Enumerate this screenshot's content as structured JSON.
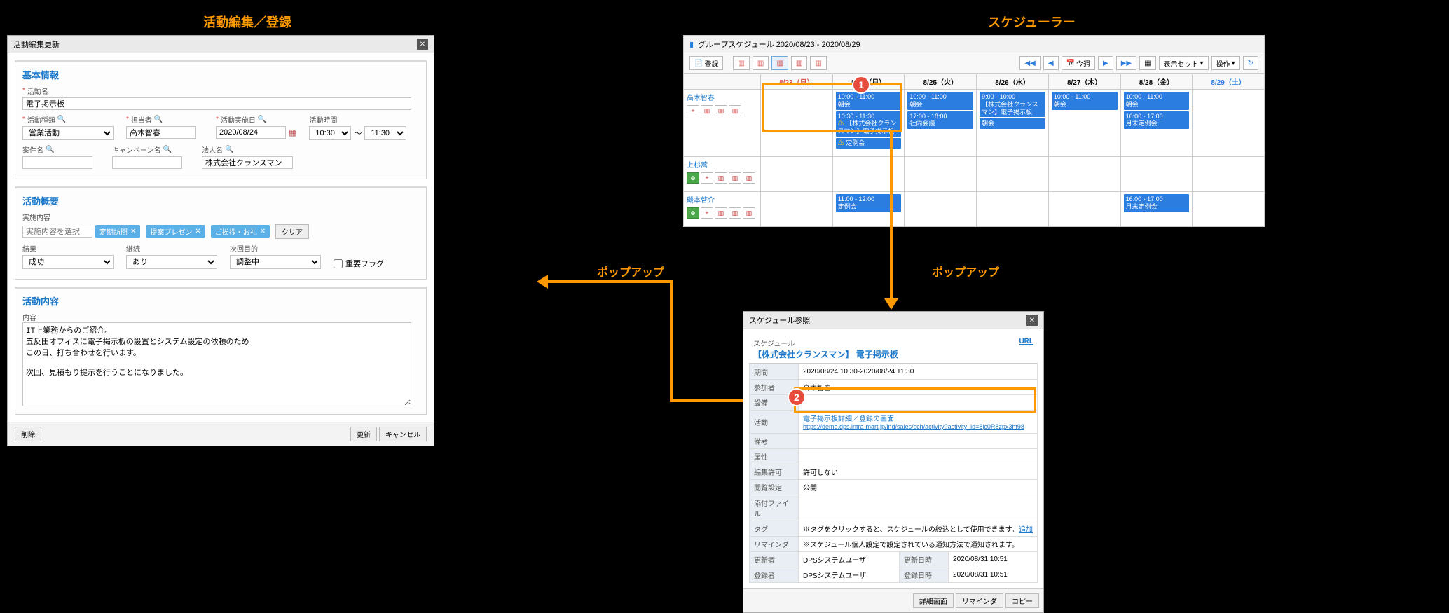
{
  "titles": {
    "left": "活動編集／登録",
    "right": "スケジューラー"
  },
  "editwin": {
    "title": "活動編集更新",
    "sec1": "基本情報",
    "f_name_l": "活動名",
    "f_name_v": "電子掲示板",
    "f_type_l": "活動種類",
    "f_type_v": "営業活動",
    "f_owner_l": "担当者",
    "f_owner_v": "高木智春",
    "f_date_l": "活動実施日",
    "f_date_v": "2020/08/24",
    "f_time_l": "活動時間",
    "f_time_from": "10:30",
    "f_time_to": "11:30",
    "f_acc_l": "案件名",
    "f_camp_l": "キャンペーン名",
    "f_corp_l": "法人名",
    "f_corp_v": "株式会社クランスマン",
    "sec2": "活動概要",
    "f_content_l": "実施内容",
    "f_content_ph": "実施内容を選択",
    "tag1": "定期訪問",
    "tag2": "提案プレゼン",
    "tag3": "ご挨拶・お礼",
    "clear": "クリア",
    "f_result_l": "結果",
    "f_result_v": "成功",
    "f_cont_l": "継続",
    "f_cont_v": "あり",
    "f_next_l": "次回目的",
    "f_next_v": "調整中",
    "f_flag": "重要フラグ",
    "sec3": "活動内容",
    "f_body_l": "内容",
    "f_body_v": "IT上業務からのご紹介。\n五反田オフィスに電子掲示板の設置とシステム設定の依頼のため\nこの日、打ち合わせを行います。\n\n次回、見積もり提示を行うことになりました。",
    "btn_del": "削除",
    "btn_upd": "更新",
    "btn_cancel": "キャンセル"
  },
  "sched": {
    "title": "グループスケジュール 2020/08/23 - 2020/08/29",
    "reg": "登録",
    "today": "今週",
    "viewset": "表示セット",
    "ops": "操作",
    "days": [
      "8/23（日）",
      "8/24（月）",
      "8/25（火）",
      "8/26（水）",
      "8/27（木）",
      "8/28（金）",
      "8/29（土）"
    ],
    "users": [
      "高木智春",
      "上杉蕎",
      "磯本啓介"
    ],
    "u1": {
      "mon": [
        {
          "t": "10:00 - 11:00",
          "s": "朝会"
        },
        {
          "t": "10:30 - 11:30",
          "s": "【株式会社クランスマン】電子掲示板",
          "w": true
        },
        {
          "t": "",
          "s": "定例会",
          "w": true
        }
      ],
      "tue": [
        {
          "t": "10:00 - 11:00",
          "s": "朝会"
        },
        {
          "t": "17:00 - 18:00",
          "s": "社内会議"
        }
      ],
      "wed": [
        {
          "t": "9:00 - 10:00",
          "s": "【株式会社クランスマン】電子掲示板"
        },
        {
          "t": "",
          "s": "朝会"
        }
      ],
      "thu": [
        {
          "t": "10:00 - 11:00",
          "s": "朝会"
        }
      ],
      "fri": [
        {
          "t": "10:00 - 11:00",
          "s": "朝会"
        },
        {
          "t": "16:00 - 17:00",
          "s": "月末定例会"
        }
      ]
    },
    "u3": {
      "mon": [
        {
          "t": "11:00 - 12:00",
          "s": "定例会"
        }
      ],
      "fri": [
        {
          "t": "16:00 - 17:00",
          "s": "月末定例会"
        }
      ]
    }
  },
  "popup": {
    "title": "スケジュール参照",
    "sub_l": "スケジュール",
    "url": "URL",
    "subject": "【株式会社クランスマン】 電子掲示板",
    "r_period_l": "期間",
    "r_period_v": "2020/08/24 10:30-2020/08/24 11:30",
    "r_attend_l": "参加者",
    "r_attend_v": "高木智春",
    "r_equip_l": "設備",
    "r_act_l": "活動",
    "r_act_link": "電子掲示板詳細／登録の画面",
    "r_act_url": "https://demo.dps.intra-mart.jp/ind/sales/sch/activity?activity_id=8jc0R8zpx3ht98",
    "r_memo_l": "備考",
    "r_attr_l": "属性",
    "r_perm_l": "編集許可",
    "r_perm_v": "許可しない",
    "r_pub_l": "閲覧設定",
    "r_pub_v": "公開",
    "r_file_l": "添付ファイル",
    "r_tag_l": "タグ",
    "r_tag_v": "※タグをクリックすると、スケジュールの絞込として使用できます。",
    "r_tag_add": "追加",
    "r_remind_l": "リマインダ",
    "r_remind_v": "※スケジュール個人設定で設定されている通知方法で通知されます。",
    "r_upd_l": "更新者",
    "r_upd_v": "DPSシステムユーザ",
    "r_updt_l": "更新日時",
    "r_updt_v": "2020/08/31 10:51",
    "r_cre_l": "登録者",
    "r_cre_v": "DPSシステムユーザ",
    "r_cret_l": "登録日時",
    "r_cret_v": "2020/08/31 10:51",
    "b1": "詳細画面",
    "b2": "リマインダ",
    "b3": "コピー"
  },
  "call": {
    "popup": "ポップアップ"
  }
}
